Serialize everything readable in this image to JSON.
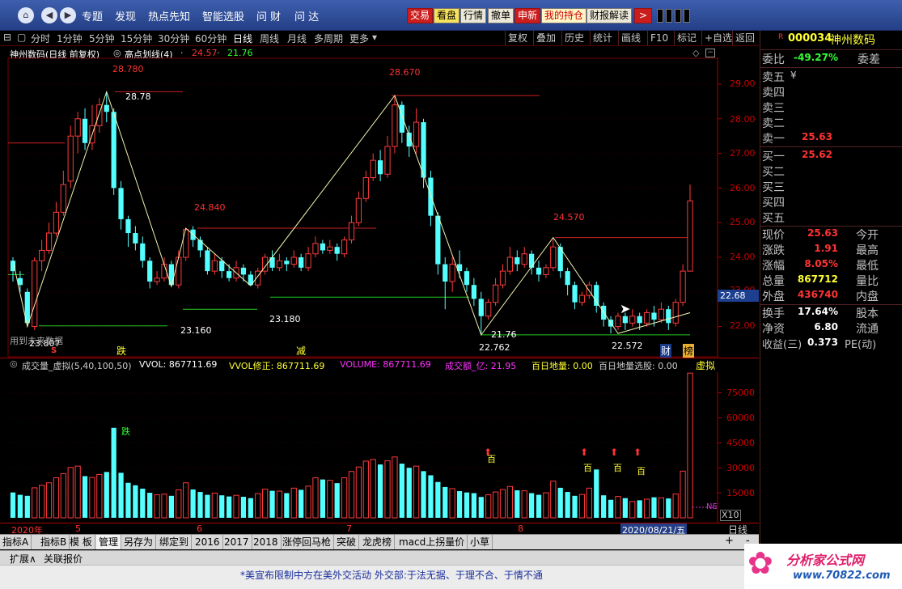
{
  "top": {
    "menu": [
      "专题",
      "发现",
      "热点先知",
      "智能选股",
      "问 财",
      "问 达"
    ],
    "buttons": [
      "交易",
      "看盘",
      "行情",
      "撤单",
      "申新",
      "我的持仓",
      "财报解读"
    ],
    "more": ">"
  },
  "periods": {
    "items": [
      "分时",
      "1分钟",
      "5分钟",
      "15分钟",
      "30分钟",
      "60分钟",
      "日线",
      "周线",
      "月线",
      "多周期",
      "更多"
    ],
    "selected": "日线",
    "right": [
      "复权",
      "叠加",
      "历史",
      "统计",
      "画线",
      "F10",
      "标记",
      "+自选",
      "返回"
    ]
  },
  "kline": {
    "title": "神州数码(日线 前复权)",
    "indicator": "高点划线(4)",
    "v1": "24.57",
    "v2": "21.76",
    "prices": [
      "29.00",
      "28.00",
      "27.00",
      "26.00",
      "25.00",
      "24.00",
      "23.00",
      "22.00"
    ],
    "current_price": "22.68",
    "annotations": [
      "28.780",
      "28.78",
      "28.670",
      "24.840",
      "24.570",
      "23.807",
      "23.160",
      "23.180",
      "21.76",
      "22.762",
      "22.572"
    ],
    "markers": {
      "up_hint": "用到未来数据",
      "s": "S",
      "die": "跌",
      "jian": "减",
      "cai": "财",
      "bang": "榜"
    }
  },
  "volume": {
    "header": [
      "成交量_虚拟(5,40,100,50)",
      "VVOL: 867711.69",
      "VVOL修正: 867711.69",
      "VOLUME: 867711.69",
      "成交额_亿: 21.95",
      "百日地量: 0.00",
      "百日地量选股: 0.00"
    ],
    "virtual": "虚拟",
    "levels": [
      "75000",
      "60000",
      "45000",
      "30000",
      "15000"
    ],
    "unit": "X10",
    "ne": "NE",
    "die": "跌",
    "bai": "百"
  },
  "xaxis": {
    "labels": [
      "2020年",
      "5",
      "6",
      "7",
      "8"
    ],
    "date": "2020/08/21/五",
    "period": "日线"
  },
  "quote": {
    "flag": "R",
    "code": "000034",
    "name": "神州数码",
    "webi_label": "委比",
    "webi_value": "-49.27%",
    "wecha_label": "委差",
    "sells": [
      {
        "label": "卖五",
        "value": "",
        "extra": "¥"
      },
      {
        "label": "卖四",
        "value": ""
      },
      {
        "label": "卖三",
        "value": ""
      },
      {
        "label": "卖二",
        "value": ""
      },
      {
        "label": "卖一",
        "value": "25.63"
      }
    ],
    "buys": [
      {
        "label": "买一",
        "value": "25.62"
      },
      {
        "label": "买二",
        "value": ""
      },
      {
        "label": "买三",
        "value": ""
      },
      {
        "label": "买四",
        "value": ""
      },
      {
        "label": "买五",
        "value": ""
      }
    ],
    "stats": [
      {
        "l": "现价",
        "v": "25.63",
        "r": "今开"
      },
      {
        "l": "涨跌",
        "v": "1.91",
        "r": "最高"
      },
      {
        "l": "涨幅",
        "v": "8.05%",
        "r": "最低"
      },
      {
        "l": "总量",
        "v": "867712",
        "r": "量比",
        "yellow": true
      },
      {
        "l": "外盘",
        "v": "436740",
        "r": "内盘"
      }
    ],
    "stats2": [
      {
        "l": "换手",
        "v": "17.64%",
        "r": "股本"
      },
      {
        "l": "净资",
        "v": "6.80",
        "r": "流通"
      },
      {
        "l": "收益(三)",
        "v": "0.373",
        "r": "PE(动)"
      }
    ]
  },
  "tabs": [
    "指标A",
    "指标B",
    "模 板",
    "管理",
    "另存为",
    "绑定到",
    "2016",
    "2017",
    "2018",
    "涨停回马枪",
    "突破",
    "龙虎榜",
    "macd上拐量价",
    "小草"
  ],
  "bottom": {
    "expand": "扩展∧",
    "related": "关联报价",
    "plus": "+",
    "minus": "-"
  },
  "status": {
    "text": "*美宣布限制中方在美外交活动 外交部:于法无据、于理不合、于情不通",
    "logo": "分析家公式网",
    "site": "www.70822.com"
  },
  "chart_data": {
    "type": "candlestick",
    "title": "神州数码(日线 前复权)",
    "ylim": [
      21.5,
      29.6
    ],
    "ohlc": [
      [
        23.9,
        23.6,
        24.0,
        23.3
      ],
      [
        23.4,
        23.2,
        23.6,
        23.0
      ],
      [
        23.0,
        22.1,
        23.1,
        22.0
      ],
      [
        22.0,
        23.9,
        24.0,
        21.9
      ],
      [
        23.9,
        24.2,
        24.5,
        23.6
      ],
      [
        24.2,
        24.7,
        25.0,
        24.1
      ],
      [
        24.7,
        25.3,
        25.6,
        24.6
      ],
      [
        25.3,
        26.1,
        26.5,
        25.2
      ],
      [
        26.2,
        27.5,
        27.8,
        26.0
      ],
      [
        27.5,
        28.0,
        28.2,
        27.0
      ],
      [
        28.0,
        27.3,
        28.3,
        27.1
      ],
      [
        27.3,
        27.8,
        28.4,
        27.1
      ],
      [
        27.8,
        28.4,
        28.6,
        27.6
      ],
      [
        28.4,
        28.2,
        28.78,
        27.9
      ],
      [
        28.2,
        26.0,
        28.3,
        25.8
      ],
      [
        26.0,
        25.1,
        26.2,
        24.8
      ],
      [
        25.1,
        24.7,
        25.2,
        24.3
      ],
      [
        24.7,
        24.4,
        24.9,
        24.2
      ],
      [
        24.4,
        23.9,
        24.6,
        23.7
      ],
      [
        23.9,
        23.3,
        24.0,
        23.1
      ],
      [
        23.3,
        23.4,
        23.6,
        23.2
      ],
      [
        23.4,
        23.8,
        24.0,
        23.3
      ],
      [
        23.8,
        23.2,
        23.9,
        23.16
      ],
      [
        23.2,
        24.0,
        24.2,
        23.1
      ],
      [
        24.0,
        24.8,
        24.84,
        23.9
      ],
      [
        24.8,
        24.5,
        24.9,
        24.3
      ],
      [
        24.5,
        24.2,
        24.6,
        24.0
      ],
      [
        24.2,
        23.6,
        24.3,
        23.5
      ],
      [
        23.6,
        23.9,
        24.1,
        23.5
      ],
      [
        23.9,
        23.6,
        24.0,
        23.4
      ],
      [
        23.6,
        23.4,
        23.8,
        23.3
      ],
      [
        23.4,
        23.7,
        23.9,
        23.3
      ],
      [
        23.7,
        23.5,
        23.8,
        23.3
      ],
      [
        23.5,
        23.2,
        23.6,
        23.18
      ],
      [
        23.2,
        23.6,
        23.7,
        23.1
      ],
      [
        23.6,
        24.0,
        24.1,
        23.5
      ],
      [
        24.0,
        23.7,
        24.2,
        23.6
      ],
      [
        23.7,
        23.9,
        24.1,
        23.6
      ],
      [
        23.9,
        23.8,
        24.0,
        23.6
      ],
      [
        23.8,
        24.0,
        24.2,
        23.7
      ],
      [
        24.0,
        23.7,
        24.1,
        23.6
      ],
      [
        23.7,
        24.1,
        24.3,
        23.6
      ],
      [
        24.1,
        24.4,
        24.6,
        24.0
      ],
      [
        24.4,
        24.2,
        24.5,
        24.1
      ],
      [
        24.2,
        24.3,
        24.5,
        24.1
      ],
      [
        24.3,
        24.1,
        24.4,
        23.9
      ],
      [
        24.1,
        24.5,
        24.6,
        24.0
      ],
      [
        24.5,
        25.0,
        25.2,
        24.4
      ],
      [
        25.0,
        25.7,
        25.9,
        24.9
      ],
      [
        25.7,
        26.3,
        26.5,
        25.6
      ],
      [
        26.3,
        26.8,
        27.0,
        26.2
      ],
      [
        26.8,
        26.4,
        27.1,
        26.2
      ],
      [
        26.4,
        27.2,
        27.5,
        26.3
      ],
      [
        27.2,
        28.4,
        28.67,
        27.0
      ],
      [
        28.4,
        27.6,
        28.5,
        27.3
      ],
      [
        27.6,
        27.2,
        27.8,
        26.9
      ],
      [
        27.2,
        27.9,
        28.3,
        27.0
      ],
      [
        27.9,
        26.3,
        28.0,
        26.0
      ],
      [
        26.3,
        25.2,
        26.5,
        24.9
      ],
      [
        25.2,
        23.8,
        25.3,
        23.5
      ],
      [
        23.8,
        23.3,
        24.0,
        22.5
      ],
      [
        23.3,
        23.8,
        24.0,
        23.0
      ],
      [
        23.8,
        23.6,
        24.2,
        23.4
      ],
      [
        23.6,
        23.2,
        23.7,
        23.0
      ],
      [
        23.2,
        22.8,
        23.4,
        22.6
      ],
      [
        22.8,
        22.3,
        23.0,
        21.76
      ],
      [
        22.3,
        22.7,
        22.8,
        22.2
      ],
      [
        22.7,
        23.2,
        23.4,
        22.6
      ],
      [
        23.2,
        23.6,
        23.8,
        23.1
      ],
      [
        23.6,
        24.0,
        24.3,
        23.5
      ],
      [
        24.0,
        23.8,
        24.2,
        23.6
      ],
      [
        23.8,
        24.1,
        24.3,
        23.7
      ],
      [
        24.1,
        23.7,
        24.2,
        23.5
      ],
      [
        23.7,
        23.5,
        23.9,
        23.3
      ],
      [
        23.5,
        23.7,
        23.8,
        23.4
      ],
      [
        23.7,
        24.3,
        24.57,
        23.6
      ],
      [
        24.3,
        23.6,
        24.4,
        23.4
      ],
      [
        23.6,
        23.2,
        23.7,
        22.9
      ],
      [
        23.2,
        22.7,
        23.3,
        22.5
      ],
      [
        22.7,
        22.9,
        23.0,
        22.6
      ],
      [
        22.9,
        23.2,
        23.3,
        22.8
      ],
      [
        23.2,
        22.6,
        23.3,
        22.4
      ],
      [
        22.6,
        22.2,
        22.7,
        22.0
      ],
      [
        22.2,
        22.0,
        22.3,
        21.8
      ],
      [
        22.0,
        22.3,
        22.4,
        21.9
      ],
      [
        22.3,
        22.1,
        22.4,
        21.9
      ],
      [
        22.1,
        22.3,
        22.5,
        22.0
      ],
      [
        22.3,
        22.1,
        22.4,
        21.9
      ],
      [
        22.1,
        22.4,
        22.5,
        22.0
      ],
      [
        22.4,
        22.2,
        22.6,
        22.0
      ],
      [
        22.2,
        22.5,
        22.7,
        22.1
      ],
      [
        22.5,
        22.1,
        22.6,
        21.9
      ],
      [
        22.1,
        22.7,
        22.8,
        22.0
      ],
      [
        22.7,
        23.6,
        23.8,
        22.6
      ],
      [
        23.6,
        25.63,
        26.1,
        23.6
      ]
    ],
    "volume": [
      15200,
      13800,
      13200,
      18000,
      19500,
      21000,
      24000,
      26500,
      30200,
      31000,
      25000,
      24200,
      26000,
      27500,
      54000,
      27000,
      21000,
      19500,
      17500,
      15000,
      13800,
      14200,
      13200,
      16800,
      21000,
      17000,
      15500,
      13800,
      14800,
      13500,
      12800,
      13500,
      12600,
      11800,
      14500,
      17200,
      16200,
      16000,
      14800,
      17800,
      16800,
      19000,
      24000,
      23000,
      22500,
      20800,
      24000,
      27800,
      30500,
      34000,
      35000,
      32000,
      34200,
      36500,
      32500,
      30000,
      31000,
      28000,
      25500,
      21500,
      18500,
      17500,
      16000,
      15200,
      14800,
      12500,
      13800,
      15500,
      17000,
      18800,
      16500,
      16200,
      14800,
      13800,
      15000,
      22000,
      18000,
      15500,
      13200,
      14000,
      17800,
      29000,
      13500,
      10800,
      12800,
      11800,
      9800,
      10500,
      11200,
      12300,
      12000,
      11600,
      14300,
      28000,
      86800
    ]
  }
}
